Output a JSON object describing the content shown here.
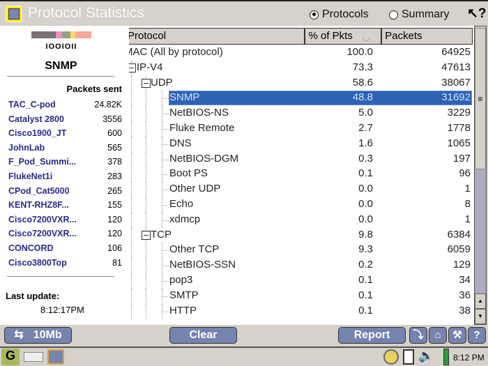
{
  "window": {
    "title": "Protocol Statistics",
    "radio_protocols": "Protocols",
    "radio_summary": "Summary",
    "selected_view": "Protocols",
    "help_icon": "?"
  },
  "left_panel": {
    "logo_text": "IOOIOII",
    "logo_colors": [
      "#7a7075",
      "#f08cbc",
      "#98a088",
      "#f8d868",
      "#f8a898"
    ],
    "protocol": "SNMP",
    "packets_sent_label": "Packets sent",
    "devices": [
      {
        "name": "TAC_C-pod",
        "value": "24.82K"
      },
      {
        "name": "Catalyst 2800",
        "value": "3556"
      },
      {
        "name": "Cisco1900_JT",
        "value": "600"
      },
      {
        "name": "JohnLab",
        "value": "565"
      },
      {
        "name": "F_Pod_Summi...",
        "value": "378"
      },
      {
        "name": "FlukeNet1i",
        "value": "283"
      },
      {
        "name": "CPod_Cat5000",
        "value": "265"
      },
      {
        "name": "KENT-RHZ8F...",
        "value": "155"
      },
      {
        "name": "Cisco7200VXR...",
        "value": "120"
      },
      {
        "name": "Cisco7200VXR...",
        "value": "120"
      },
      {
        "name": "CONCORD",
        "value": "106"
      },
      {
        "name": "Cisco3800Top",
        "value": "81"
      }
    ],
    "last_update_label": "Last update:",
    "last_update_time": "8:12:17PM"
  },
  "table": {
    "columns": [
      "Protocol",
      "% of Pkts",
      "Packets"
    ],
    "sort_column": "% of Pkts",
    "selected": "SNMP",
    "rows": [
      {
        "name": "MAC (All by protocol)",
        "pct": "100.0",
        "packets": "64925",
        "level": 0
      },
      {
        "name": "IP-V4",
        "pct": "73.3",
        "packets": "47613",
        "level": 1,
        "expanded": true
      },
      {
        "name": "UDP",
        "pct": "58.6",
        "packets": "38067",
        "level": 2,
        "expanded": true
      },
      {
        "name": "SNMP",
        "pct": "48.8",
        "packets": "31692",
        "level": 3
      },
      {
        "name": "NetBIOS-NS",
        "pct": "5.0",
        "packets": "3229",
        "level": 3
      },
      {
        "name": "Fluke Remote",
        "pct": "2.7",
        "packets": "1778",
        "level": 3
      },
      {
        "name": "DNS",
        "pct": "1.6",
        "packets": "1065",
        "level": 3
      },
      {
        "name": "NetBIOS-DGM",
        "pct": "0.3",
        "packets": "197",
        "level": 3
      },
      {
        "name": "Boot PS",
        "pct": "0.1",
        "packets": "96",
        "level": 3
      },
      {
        "name": "Other UDP",
        "pct": "0.0",
        "packets": "1",
        "level": 3
      },
      {
        "name": "Echo",
        "pct": "0.0",
        "packets": "8",
        "level": 3
      },
      {
        "name": "xdmcp",
        "pct": "0.0",
        "packets": "1",
        "level": 3
      },
      {
        "name": "TCP",
        "pct": "9.8",
        "packets": "6384",
        "level": 2,
        "expanded": true
      },
      {
        "name": "Other TCP",
        "pct": "9.3",
        "packets": "6059",
        "level": 3
      },
      {
        "name": "NetBIOS-SSN",
        "pct": "0.2",
        "packets": "129",
        "level": 3
      },
      {
        "name": "pop3",
        "pct": "0.1",
        "packets": "34",
        "level": 3
      },
      {
        "name": "SMTP",
        "pct": "0.1",
        "packets": "36",
        "level": 3
      },
      {
        "name": "HTTP",
        "pct": "0.1",
        "packets": "38",
        "level": 3
      }
    ]
  },
  "buttons": {
    "speed": "10Mb",
    "clear": "Clear",
    "report": "Report"
  },
  "taskbar": {
    "clock": "8:12 PM"
  }
}
